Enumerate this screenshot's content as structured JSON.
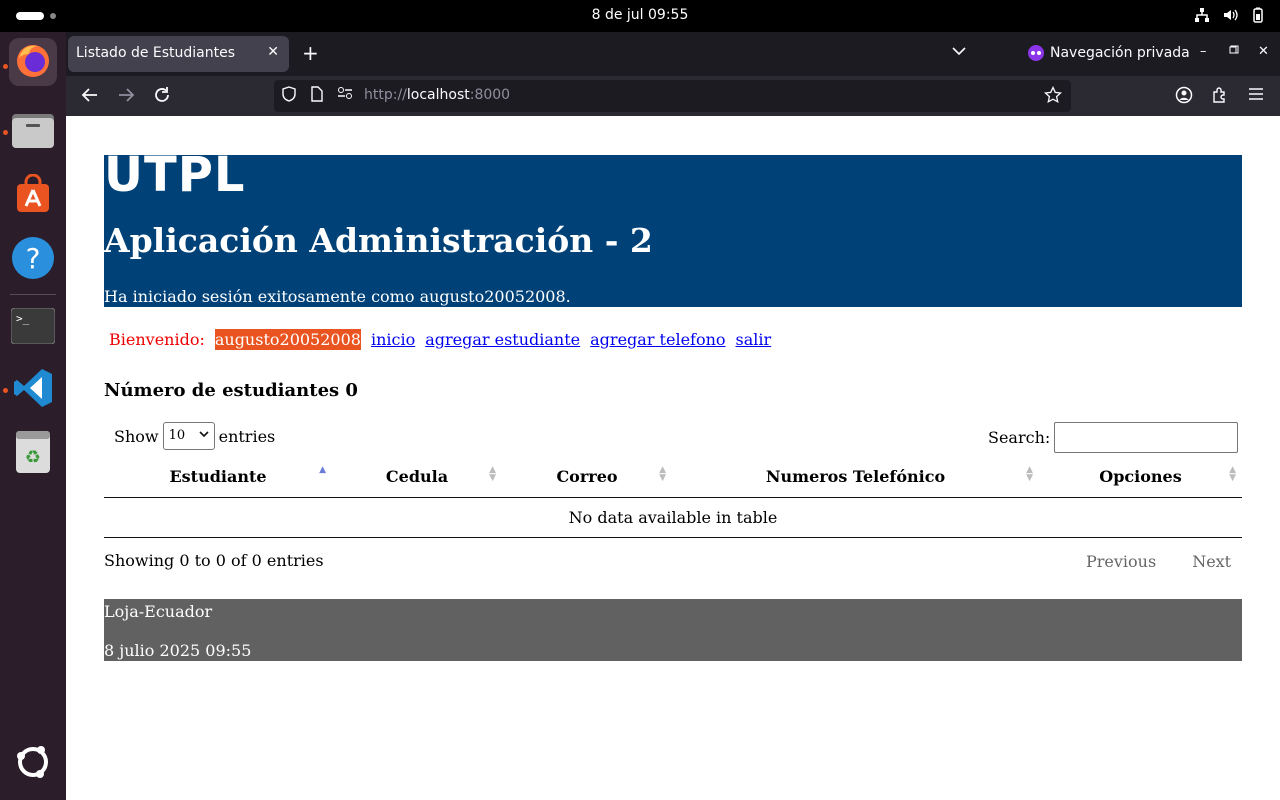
{
  "topbar": {
    "clock": "8 de jul  09:55"
  },
  "dock": {
    "apps": [
      "firefox-icon",
      "files-icon",
      "app-center-icon",
      "help-icon",
      "terminal-icon",
      "vscode-icon",
      "trash-icon",
      "ubuntu-icon"
    ]
  },
  "browser": {
    "tab_title": "Listado de Estudiantes",
    "private_label": "Navegación privada",
    "url_scheme": "http://",
    "url_host": "localhost",
    "url_port": ":8000"
  },
  "page": {
    "logo": "UTPL",
    "app_title": "Aplicación Administración - 2",
    "login_message": "Ha iniciado sesión exitosamente como augusto20052008.",
    "menu": {
      "welcome": "Bienvenido:",
      "username": "augusto20052008",
      "links": [
        "inicio",
        "agregar estudiante",
        "agregar telefono",
        "salir"
      ]
    },
    "count_title": "Número de estudiantes 0",
    "table": {
      "show_label": "Show",
      "show_value": "10",
      "entries_label": "entries",
      "search_label": "Search:",
      "columns": [
        "Estudiante",
        "Cedula",
        "Correo",
        "Numeros Telefónico",
        "Opciones"
      ],
      "empty_message": "No data available in table",
      "info": "Showing 0 to 0 of 0 entries",
      "previous": "Previous",
      "next": "Next"
    },
    "footer": {
      "location": "Loja-Ecuador",
      "datetime": "8 julio 2025 09:55"
    }
  }
}
